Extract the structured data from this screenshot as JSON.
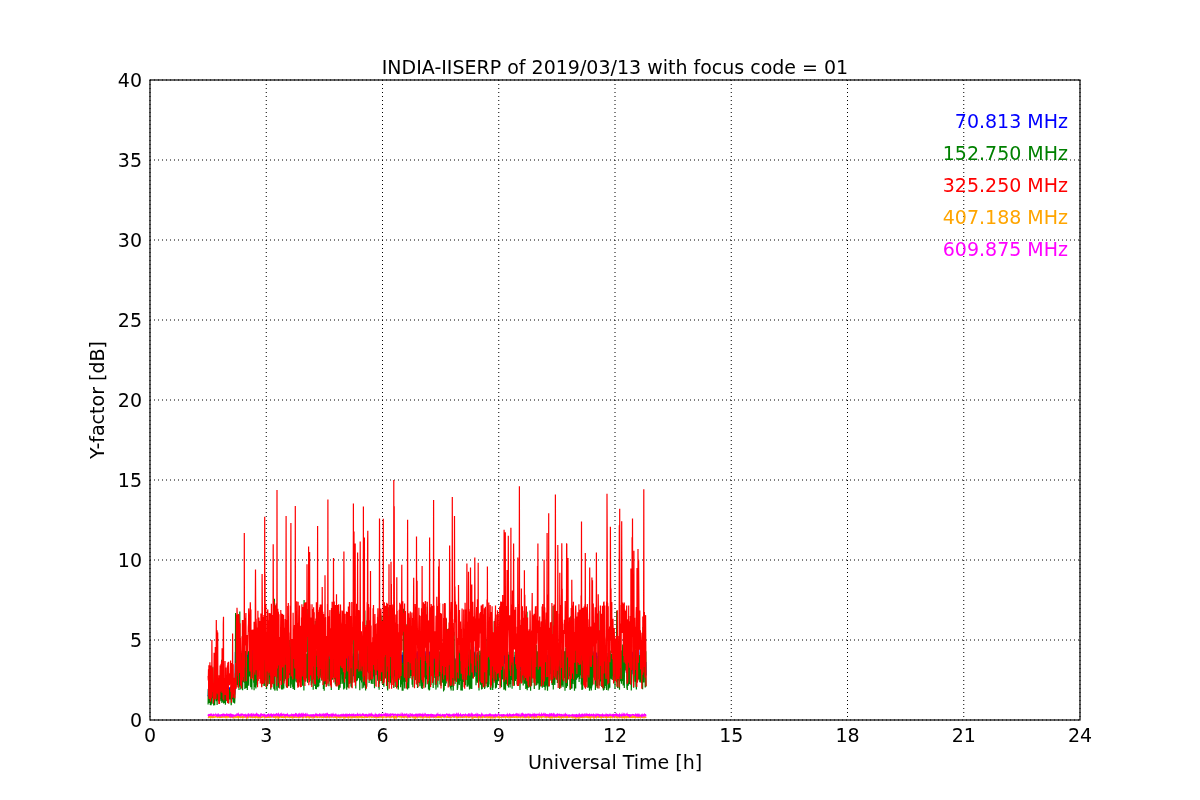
{
  "plot": {
    "title": "INDIA-IISERP of 2019/03/13 with focus code = 01",
    "xlabel": "Universal Time [h]",
    "ylabel": "Y-factor [dB]",
    "xticks": [
      "0",
      "3",
      "6",
      "9",
      "12",
      "15",
      "18",
      "21",
      "24"
    ],
    "yticks": [
      "40",
      "35",
      "30",
      "25",
      "20",
      "15",
      "10",
      "5",
      "0"
    ],
    "legend": [
      {
        "label": "70.813 MHz",
        "color": "#0000ff"
      },
      {
        "label": "152.750 MHz",
        "color": "#008000"
      },
      {
        "label": "325.250 MHz",
        "color": "#ff0000"
      },
      {
        "label": "407.188 MHz",
        "color": "#ffa500"
      },
      {
        "label": "609.875 MHz",
        "color": "#ff00ff"
      }
    ]
  }
}
